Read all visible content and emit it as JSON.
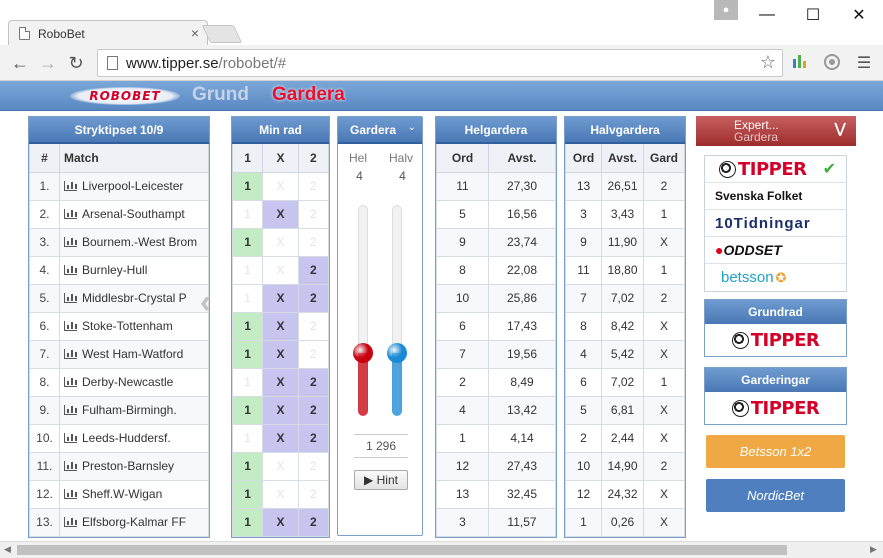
{
  "browser": {
    "tab_title": "RoboBet",
    "tab_close": "×",
    "url_host": "www.tipper.se",
    "url_path": "/robobet/#",
    "window": {
      "minimize": "—",
      "maximize": "☐",
      "close": "✕"
    }
  },
  "header": {
    "logo": "ROBOBET",
    "tab_grund": "Grund",
    "tab_gardera": "Gardera"
  },
  "stryktipset": {
    "title": "Stryktipset 10/9",
    "col_num": "#",
    "col_match": "Match",
    "rows": [
      {
        "n": "1.",
        "match": "Liverpool-Leicester"
      },
      {
        "n": "2.",
        "match": "Arsenal-Southampt"
      },
      {
        "n": "3.",
        "match": "Bournem.-West Brom"
      },
      {
        "n": "4.",
        "match": "Burnley-Hull"
      },
      {
        "n": "5.",
        "match": "Middlesbr-Crystal P"
      },
      {
        "n": "6.",
        "match": "Stoke-Tottenham"
      },
      {
        "n": "7.",
        "match": "West Ham-Watford"
      },
      {
        "n": "8.",
        "match": "Derby-Newcastle"
      },
      {
        "n": "9.",
        "match": "Fulham-Birmingh."
      },
      {
        "n": "10.",
        "match": "Leeds-Huddersf."
      },
      {
        "n": "11.",
        "match": "Preston-Barnsley"
      },
      {
        "n": "12.",
        "match": "Sheff.W-Wigan"
      },
      {
        "n": "13.",
        "match": "Elfsborg-Kalmar FF"
      }
    ]
  },
  "minrad": {
    "title": "Min rad",
    "cols": [
      "1",
      "X",
      "2"
    ],
    "rows": [
      [
        1,
        0,
        0
      ],
      [
        0,
        1,
        0
      ],
      [
        1,
        0,
        0
      ],
      [
        0,
        0,
        1
      ],
      [
        0,
        1,
        1
      ],
      [
        1,
        1,
        0
      ],
      [
        1,
        1,
        0
      ],
      [
        0,
        1,
        1
      ],
      [
        1,
        1,
        1
      ],
      [
        0,
        1,
        1
      ],
      [
        1,
        0,
        0
      ],
      [
        1,
        0,
        0
      ],
      [
        1,
        1,
        1
      ]
    ]
  },
  "gardera": {
    "title": "Gardera",
    "chevron": "⌄",
    "hel_label": "Hel",
    "halv_label": "Halv",
    "hel_value": "4",
    "halv_value": "4",
    "hel_level": 0.3,
    "halv_level": 0.3,
    "hel_color": "#c8000f",
    "halv_color": "#1a8ad6",
    "total": "1 296",
    "hint": "▶ Hint"
  },
  "helgardera": {
    "title": "Helgardera",
    "col_ord": "Ord",
    "col_avst": "Avst.",
    "rows": [
      [
        "11",
        "27,30"
      ],
      [
        "5",
        "16,56"
      ],
      [
        "9",
        "23,74"
      ],
      [
        "8",
        "22,08"
      ],
      [
        "10",
        "25,86"
      ],
      [
        "6",
        "17,43"
      ],
      [
        "7",
        "19,56"
      ],
      [
        "2",
        "8,49"
      ],
      [
        "4",
        "13,42"
      ],
      [
        "1",
        "4,14"
      ],
      [
        "12",
        "27,43"
      ],
      [
        "13",
        "32,45"
      ],
      [
        "3",
        "11,57"
      ]
    ]
  },
  "halvgardera": {
    "title": "Halvgardera",
    "col_ord": "Ord",
    "col_avst": "Avst.",
    "col_gard": "Gard",
    "rows": [
      [
        "13",
        "26,51",
        "2"
      ],
      [
        "3",
        "3,43",
        "1"
      ],
      [
        "9",
        "11,90",
        "X"
      ],
      [
        "11",
        "18,80",
        "1"
      ],
      [
        "7",
        "7,02",
        "2"
      ],
      [
        "8",
        "8,42",
        "X"
      ],
      [
        "4",
        "5,42",
        "X"
      ],
      [
        "6",
        "7,02",
        "1"
      ],
      [
        "5",
        "6,81",
        "X"
      ],
      [
        "2",
        "2,44",
        "X"
      ],
      [
        "10",
        "14,90",
        "2"
      ],
      [
        "12",
        "24,32",
        "X"
      ],
      [
        "1",
        "0,26",
        "X"
      ]
    ]
  },
  "expert": {
    "title": "Expert...",
    "subtitle": "Gardera",
    "sources": {
      "tipper": "TIPPER",
      "svenska_folket": "Svenska Folket",
      "tio": "10Tidningar",
      "oddset": "ODDSET",
      "betsson": "betsson"
    },
    "grundrad_title": "Grundrad",
    "grundrad_logo": "TIPPER",
    "garderingar_title": "Garderingar",
    "garderingar_logo": "TIPPER",
    "betsson_btn": "Betsson 1x2",
    "nordicbet_btn": "NordicBet",
    "betsson_color": "#f0a844",
    "nordicbet_color": "#4f7fbf"
  }
}
